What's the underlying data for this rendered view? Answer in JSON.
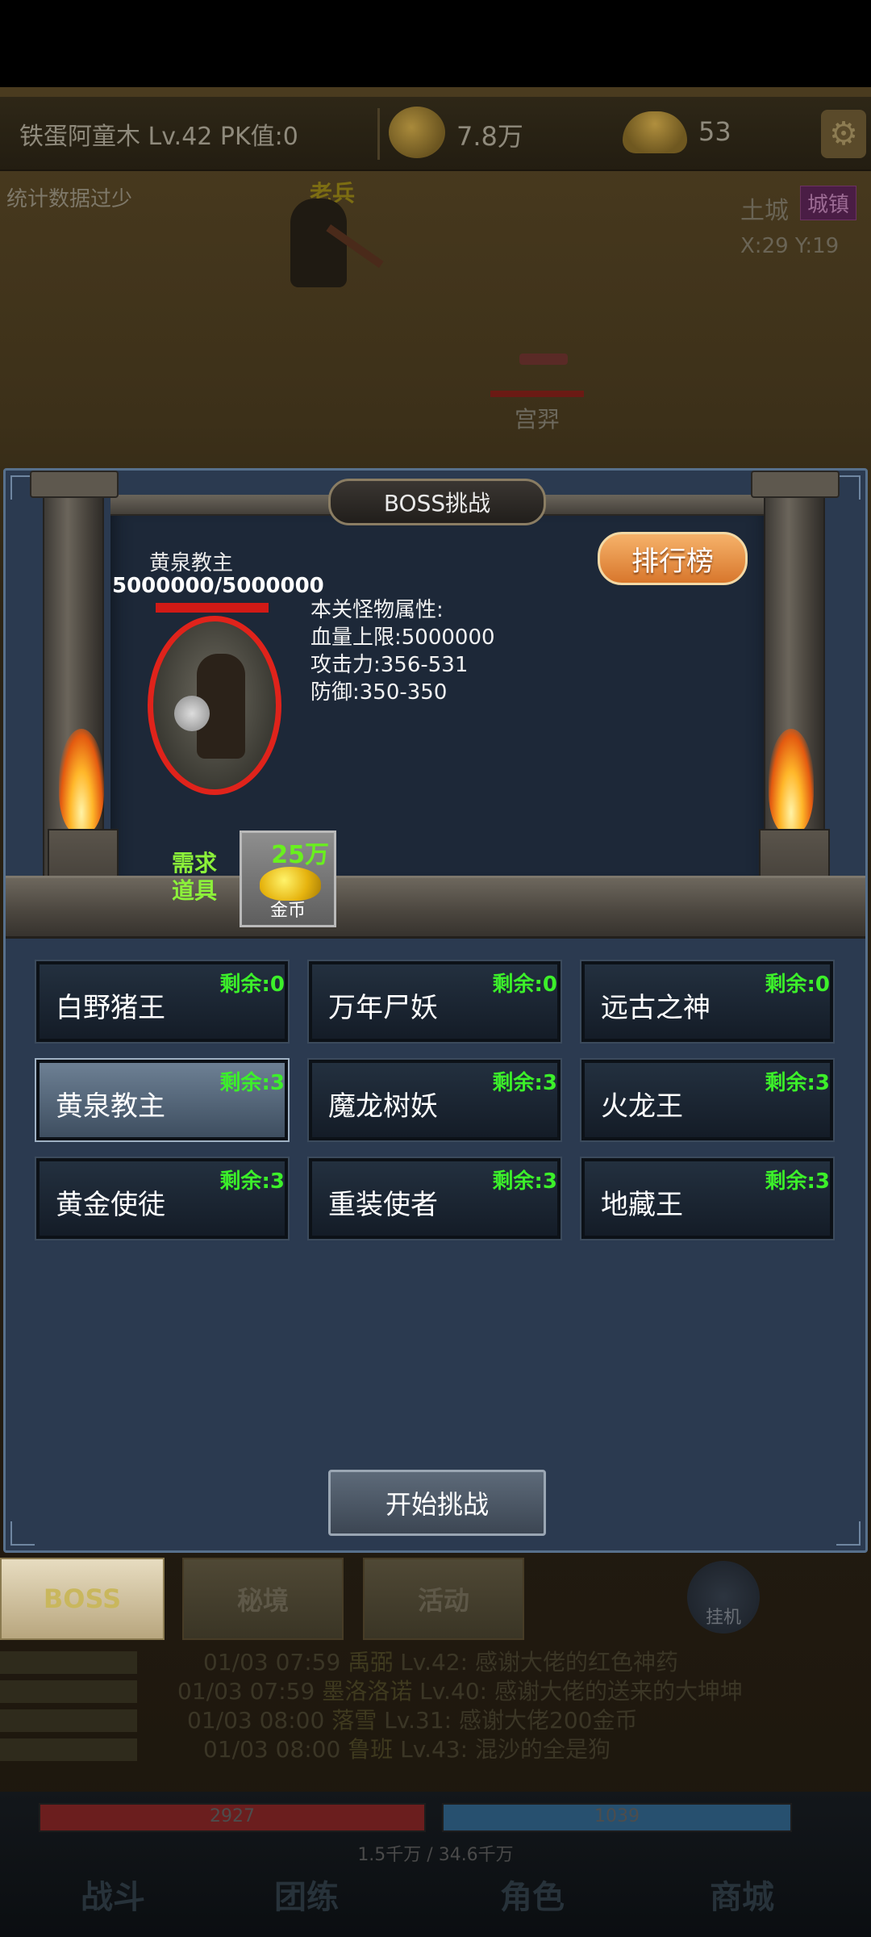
{
  "topbar": {
    "player": "铁蛋阿童木  Lv.42 PK值:0",
    "gold": "7.8万",
    "ingot": "53",
    "settings_icon": "gear-icon"
  },
  "scene": {
    "stats_warning": "统计数据过少",
    "npc_a": "老兵",
    "npc_b": "宫羿",
    "map_name": "土城",
    "map_badge": "城镇",
    "map_coords": "X:29 Y:19"
  },
  "boss_panel": {
    "title": "BOSS挑战",
    "ranking_label": "排行榜",
    "selected_boss": {
      "name": "黄泉教主",
      "hp_text": "5000000/5000000",
      "hp_fraction": 1.0
    },
    "stats": {
      "heading": "本关怪物属性:",
      "hp_limit": "血量上限:5000000",
      "attack": "攻击力:356-531",
      "defense": "防御:350-350"
    },
    "requirement": {
      "label_line1": "需求",
      "label_line2": "道具",
      "amount": "25万",
      "item_name": "金币"
    },
    "bosses": [
      {
        "name": "白野猪王",
        "remaining": "剩余:0",
        "selected": false
      },
      {
        "name": "万年尸妖",
        "remaining": "剩余:0",
        "selected": false
      },
      {
        "name": "远古之神",
        "remaining": "剩余:0",
        "selected": false
      },
      {
        "name": "黄泉教主",
        "remaining": "剩余:3",
        "selected": true
      },
      {
        "name": "魔龙树妖",
        "remaining": "剩余:3",
        "selected": false
      },
      {
        "name": "火龙王",
        "remaining": "剩余:3",
        "selected": false
      },
      {
        "name": "黄金使徒",
        "remaining": "剩余:3",
        "selected": false
      },
      {
        "name": "重装使者",
        "remaining": "剩余:3",
        "selected": false
      },
      {
        "name": "地藏王",
        "remaining": "剩余:3",
        "selected": false
      }
    ],
    "start_label": "开始挑战"
  },
  "tabs": {
    "boss": "BOSS",
    "secret": "秘境",
    "activity": "活动",
    "afk": "挂机"
  },
  "chat": [
    {
      "time": "01/03 07:59",
      "name": "禹弼",
      "level": "Lv.42:",
      "msg": "感谢大佬的红色神药"
    },
    {
      "time": "01/03 07:59",
      "name": "墨洛洛诺",
      "level": "Lv.40:",
      "msg": "感谢大佬的送来的大坤坤"
    },
    {
      "time": "01/03 08:00",
      "name": "落雪",
      "level": "Lv.31:",
      "msg": "感谢大佬200金币"
    },
    {
      "time": "01/03 08:00",
      "name": "鲁班",
      "level": "Lv.43:",
      "msg": "混沙的全是狗"
    }
  ],
  "hud": {
    "hp": "2927",
    "mp": "1039",
    "exp": "1.5千万 / 34.6千万",
    "nav": [
      "战斗",
      "团练",
      "角色",
      "商城"
    ]
  }
}
